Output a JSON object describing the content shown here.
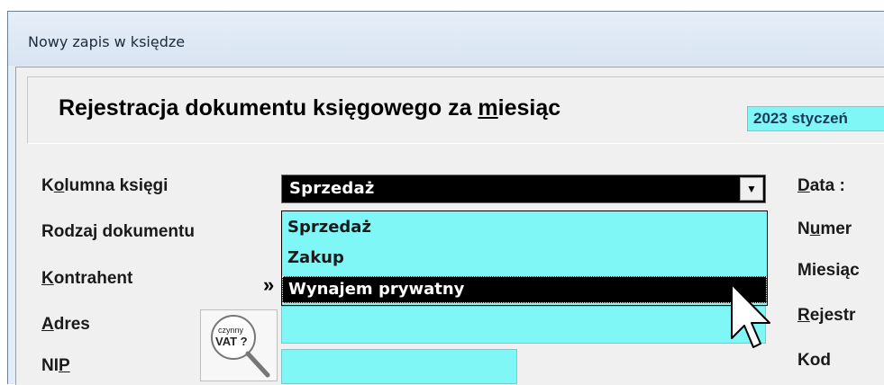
{
  "window": {
    "title": "Nowy zapis w księdze"
  },
  "header": {
    "heading_before": "Rejestracja dokumentu księgowego za ",
    "heading_underlined": "m",
    "heading_after": "iesiąc",
    "month_value": "2023 styczeń"
  },
  "labels": {
    "kolumna_pre": "K",
    "kolumna_u": "o",
    "kolumna_post": "lumna księgi",
    "rodzaj": "Rodzaj dokumentu",
    "kontrahent_u": "K",
    "kontrahent_post": "ontrahent",
    "adres_u": "A",
    "adres_post": "dres",
    "nip_pre": "NI",
    "nip_u": "P",
    "data_u": "D",
    "data_post": "ata :",
    "numer_pre": "N",
    "numer_u": "u",
    "numer_post": "mer",
    "miesiac": "Miesiąc",
    "rejestr_u": "R",
    "rejestr_post": "ejestr",
    "kod": "Kod"
  },
  "combo": {
    "value": "Sprzedaż",
    "arrow": "▼"
  },
  "dropdown": {
    "options": [
      "Sprzedaż",
      "Zakup",
      "Wynajem prywatny"
    ],
    "selected_index": 2
  },
  "kontrahent_button": "»",
  "vat_button": {
    "line1": "czynny",
    "line2": "VAT ?"
  }
}
